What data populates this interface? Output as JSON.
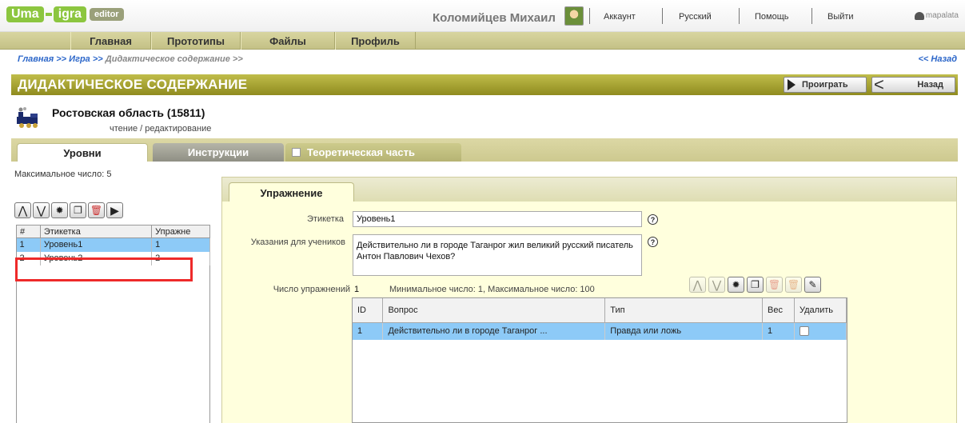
{
  "header": {
    "logo": {
      "part1": "Uma",
      "part2": "igra",
      "badge": "editor"
    },
    "user_name": "Коломийцев Михаил",
    "links": [
      "Аккаунт",
      "Русский",
      "Помощь",
      "Выйти"
    ],
    "brand": "mapalata"
  },
  "nav": {
    "items": [
      "Главная",
      "Прототипы",
      "Файлы",
      "Профиль"
    ]
  },
  "breadcrumb": {
    "part1": "Главная",
    "sep": ">>",
    "part2": "Игра",
    "part3": "Дидактическое содержание",
    "back": "<< Назад"
  },
  "title": {
    "text": "ДИДАКТИЧЕСКОЕ СОДЕРЖАНИЕ",
    "play": "Проиграть",
    "back": "Назад"
  },
  "project": {
    "title": "Ростовская область (15811)",
    "mode": "чтение / редактирование"
  },
  "tabs": {
    "levels": "Уровни",
    "instructions": "Инструкции",
    "theory": "Теоретическая часть"
  },
  "levels_panel": {
    "max_label": "Максимальное число: 5",
    "columns": [
      "#",
      "Этикетка",
      "Упражне"
    ],
    "rows": [
      {
        "num": "1",
        "label": "Уровень1",
        "count": "1"
      },
      {
        "num": "2",
        "label": "Уровень2",
        "count": "2"
      }
    ]
  },
  "exercise": {
    "tab": "Упражнение",
    "label_caption": "Этикетка",
    "label_value": "Уровень1",
    "instructions_caption": "Указания для учеников",
    "instructions_value": "Действительно ли в городе Таганрог жил великий русский писатель Антон Павлович Чехов?",
    "count_caption": "Число упражнений",
    "count_value": "1",
    "count_limits": "Минимальное число: 1,  Максимальное число: 100",
    "help_glyph": "?",
    "table": {
      "columns": [
        "ID",
        "Вопрос",
        "Тип",
        "Вес",
        "Удалить"
      ],
      "rows": [
        {
          "id": "1",
          "question": "Действительно ли в городе Таганрог ...",
          "type": "Правда или ложь",
          "weight": "1"
        }
      ]
    }
  }
}
